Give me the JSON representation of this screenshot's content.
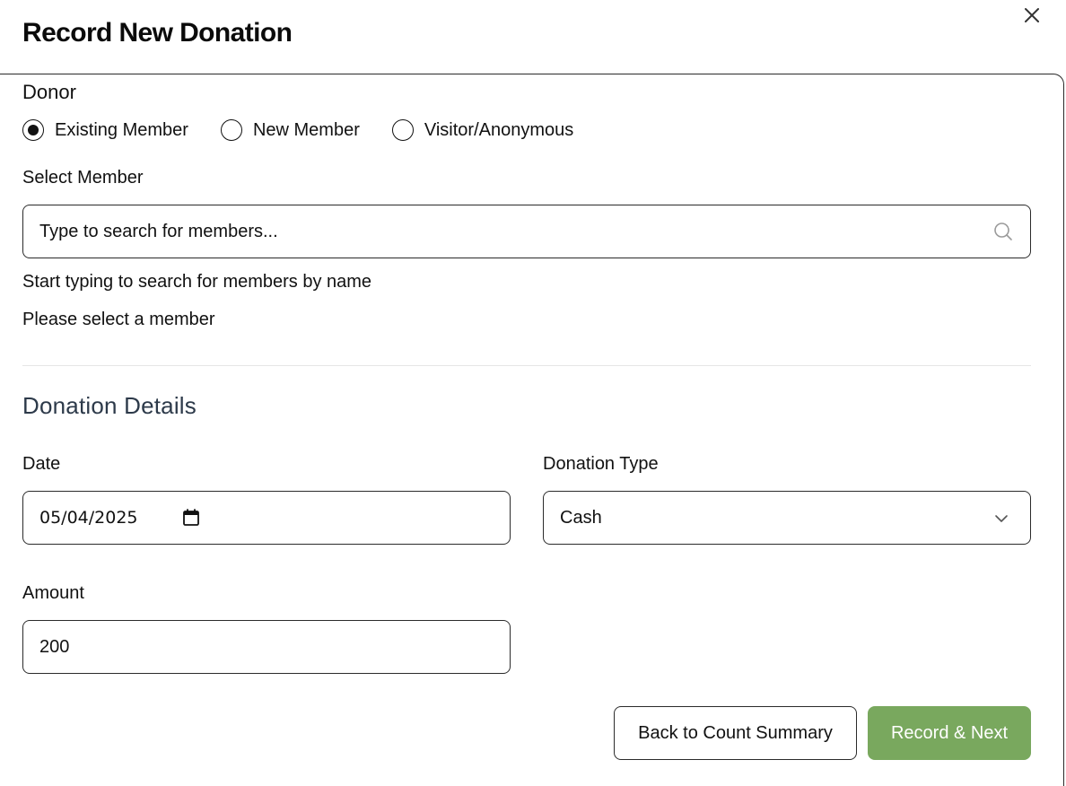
{
  "dialog": {
    "title": "Record New Donation"
  },
  "donor": {
    "label": "Donor",
    "options": [
      {
        "label": "Existing Member",
        "selected": true
      },
      {
        "label": "New Member",
        "selected": false
      },
      {
        "label": "Visitor/Anonymous",
        "selected": false
      }
    ]
  },
  "member_select": {
    "label": "Select Member",
    "placeholder": "Type to search for members...",
    "help_text": "Start typing to search for members by name",
    "error_text": "Please select a member"
  },
  "details": {
    "title": "Donation Details",
    "date_label": "Date",
    "date_value": "05/04/2025",
    "type_label": "Donation Type",
    "type_value": "Cash",
    "amount_label": "Amount",
    "amount_value": "200"
  },
  "actions": {
    "back_label": "Back to Count Summary",
    "next_label": "Record & Next"
  },
  "colors": {
    "primary_button": "#79a85e",
    "section_title": "#2d3a4a"
  }
}
